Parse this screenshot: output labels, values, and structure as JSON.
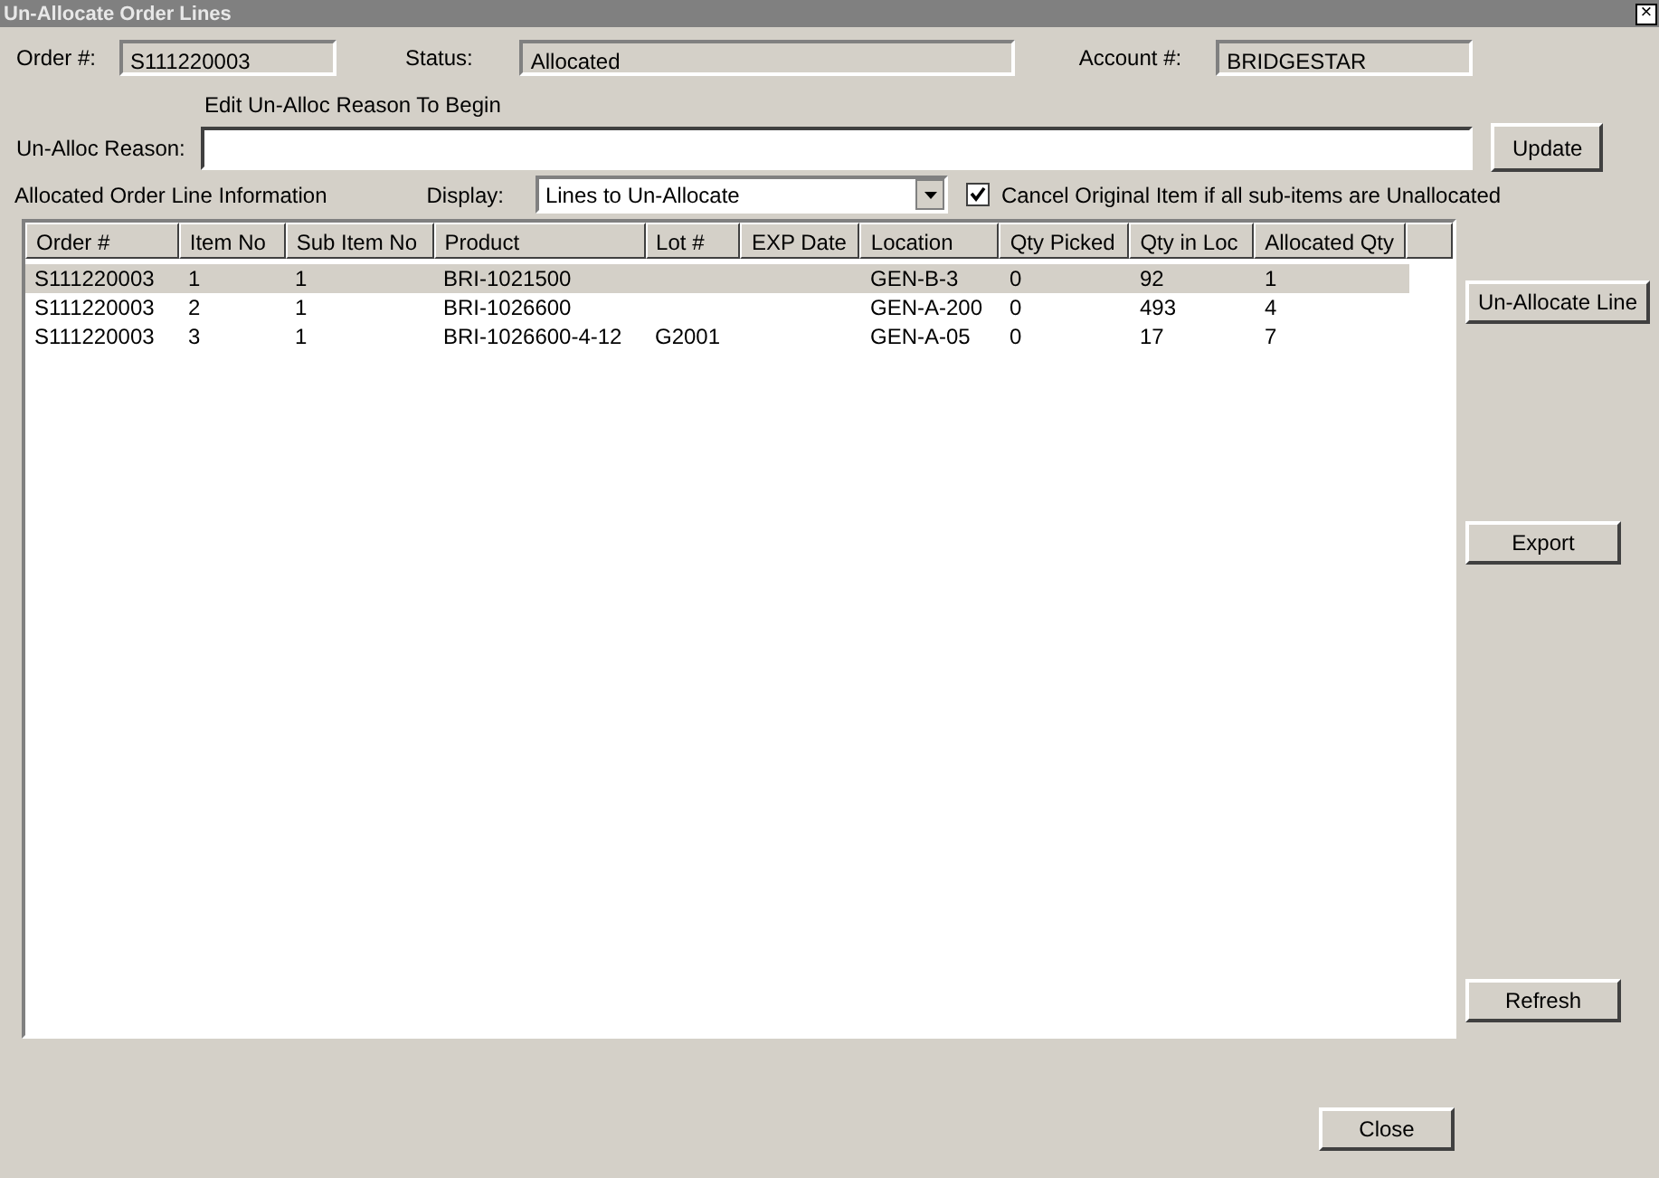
{
  "window": {
    "title": "Un-Allocate Order Lines",
    "close": "×"
  },
  "header": {
    "order_label": "Order #:",
    "order_value": "S111220003",
    "status_label": "Status:",
    "status_value": "Allocated",
    "account_label": "Account #:",
    "account_value": "BRIDGESTAR"
  },
  "reason": {
    "hint": "Edit Un-Alloc Reason To Begin",
    "label": "Un-Alloc Reason:",
    "update_button": "Update"
  },
  "section": {
    "title": "Allocated Order Line Information",
    "display_label": "Display:",
    "display_value": "Lines to Un-Allocate",
    "cancel_checkbox": {
      "label": "Cancel Original Item if all sub-items are Unallocated",
      "checked": true
    }
  },
  "table": {
    "columns": [
      "Order #",
      "Item No",
      "Sub Item No",
      "Product",
      "Lot #",
      "EXP Date",
      "Location",
      "Qty Picked",
      "Qty in Loc",
      "Allocated Qty"
    ],
    "rows": [
      {
        "selected": true,
        "cells": [
          "S111220003",
          "1",
          "1",
          "BRI-1021500",
          "",
          "",
          "GEN-B-3",
          "0",
          "92",
          "1"
        ]
      },
      {
        "selected": false,
        "cells": [
          "S111220003",
          "2",
          "1",
          "BRI-1026600",
          "",
          "",
          "GEN-A-200",
          "0",
          "493",
          "4"
        ]
      },
      {
        "selected": false,
        "cells": [
          "S111220003",
          "3",
          "1",
          "BRI-1026600-4-12",
          "G2001",
          "",
          "GEN-A-05",
          "0",
          "17",
          "7"
        ]
      }
    ]
  },
  "side_buttons": [
    "Un-Allocate Line",
    "Export",
    "Refresh"
  ],
  "close_button": "Close"
}
